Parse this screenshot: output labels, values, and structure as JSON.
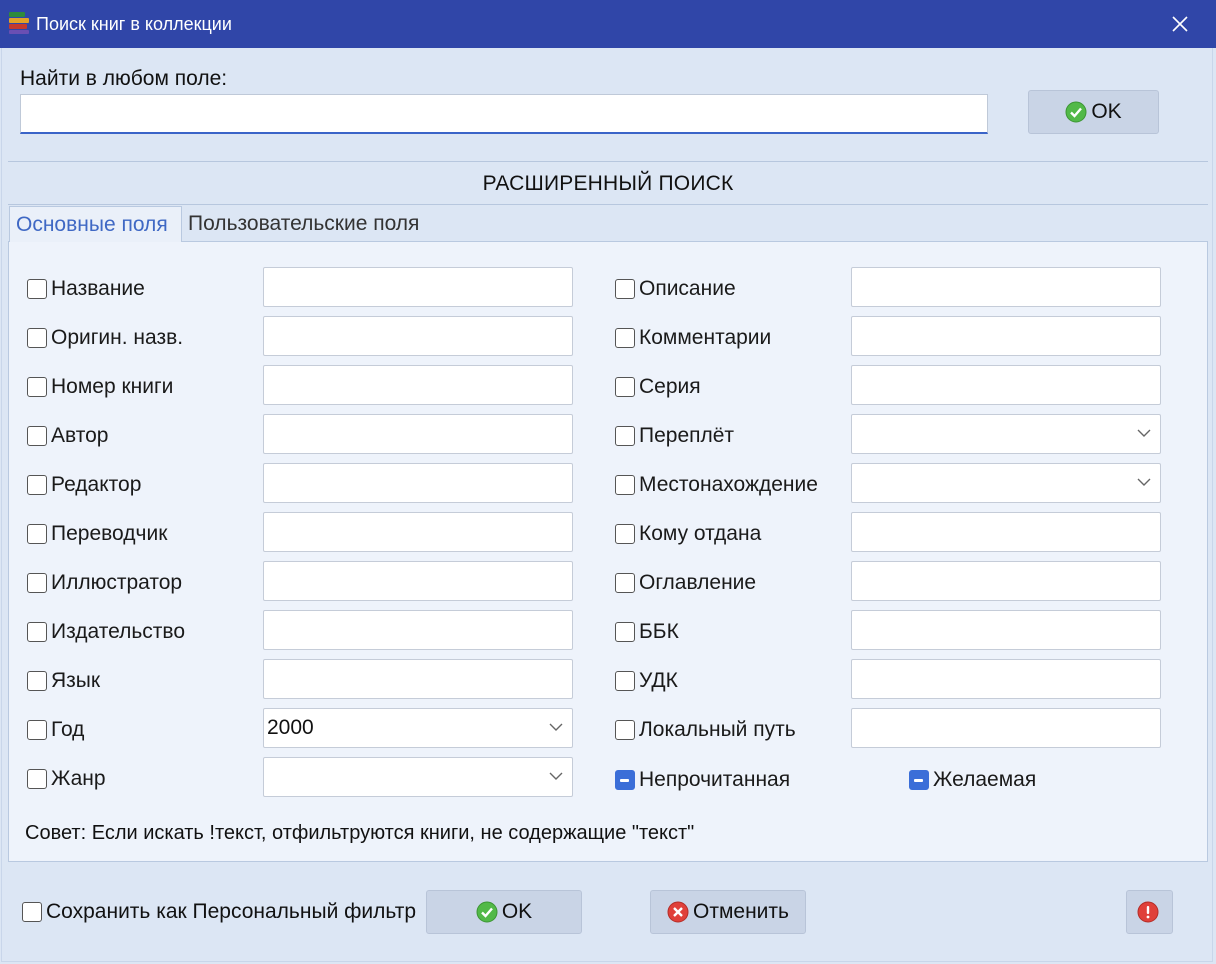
{
  "window": {
    "title": "Поиск книг в коллекции"
  },
  "quick_search": {
    "label": "Найти в любом поле:",
    "value": "",
    "ok_label": "OK"
  },
  "advanced": {
    "title": "РАСШИРЕННЫЙ ПОИСК",
    "tabs": [
      {
        "label": "Основные поля",
        "active": true
      },
      {
        "label": "Пользовательские поля",
        "active": false
      }
    ],
    "left_fields": [
      {
        "label": "Название",
        "type": "text",
        "value": ""
      },
      {
        "label": "Оригин. назв.",
        "type": "text",
        "value": ""
      },
      {
        "label": "Номер книги",
        "type": "text",
        "value": ""
      },
      {
        "label": "Автор",
        "type": "text",
        "value": ""
      },
      {
        "label": "Редактор",
        "type": "text",
        "value": ""
      },
      {
        "label": "Переводчик",
        "type": "text",
        "value": ""
      },
      {
        "label": "Иллюстратор",
        "type": "text",
        "value": ""
      },
      {
        "label": "Издательство",
        "type": "text",
        "value": ""
      },
      {
        "label": "Язык",
        "type": "text",
        "value": ""
      },
      {
        "label": "Год",
        "type": "select",
        "value": "2000"
      },
      {
        "label": "Жанр",
        "type": "select",
        "value": ""
      }
    ],
    "right_fields": [
      {
        "label": "Описание",
        "type": "text",
        "value": ""
      },
      {
        "label": "Комментарии",
        "type": "text",
        "value": ""
      },
      {
        "label": "Серия",
        "type": "text",
        "value": ""
      },
      {
        "label": "Переплёт",
        "type": "select",
        "value": ""
      },
      {
        "label": "Местонахождение",
        "type": "select",
        "value": ""
      },
      {
        "label": "Кому отдана",
        "type": "text",
        "value": ""
      },
      {
        "label": "Оглавление",
        "type": "text",
        "value": ""
      },
      {
        "label": "ББК",
        "type": "text",
        "value": ""
      },
      {
        "label": "УДК",
        "type": "text",
        "value": ""
      },
      {
        "label": "Локальный путь",
        "type": "text",
        "value": ""
      }
    ],
    "flags": [
      {
        "label": "Непрочитанная",
        "state": "indeterminate"
      },
      {
        "label": "Желаемая",
        "state": "indeterminate"
      }
    ],
    "tip": "Совет: Если искать !текст, отфильтруются книги, не содержащие \"текст\""
  },
  "footer": {
    "save_filter_label": "Сохранить как Персональный фильтр",
    "ok_label": "OK",
    "cancel_label": "Отменить"
  },
  "colors": {
    "titlebar": "#3046a8",
    "accent": "#3b6ed8",
    "background": "#dce6f4",
    "ok_icon": "#52b948",
    "cancel_icon": "#e0403a"
  }
}
